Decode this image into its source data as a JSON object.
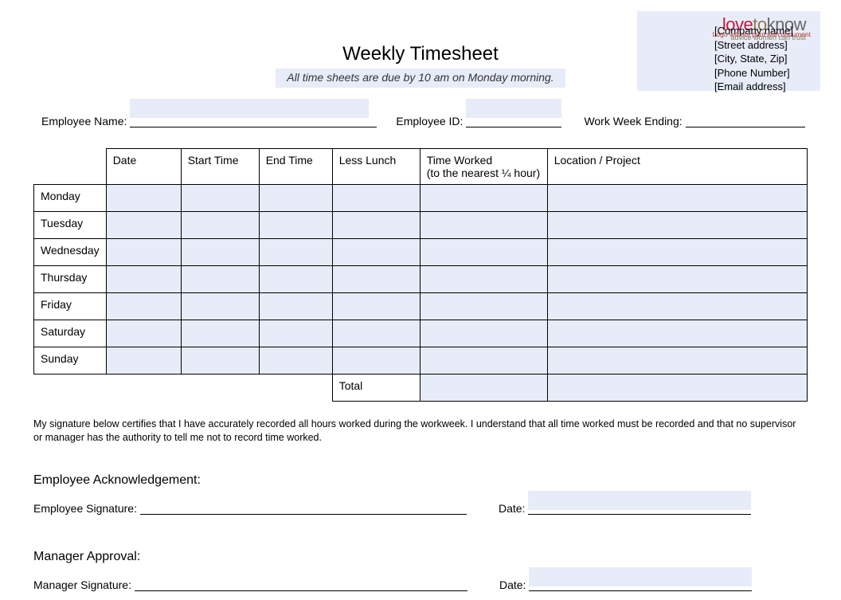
{
  "logo": {
    "love": "love",
    "to": "to",
    "know": "know",
    "tagline": "advice women can trust",
    "note": "Logo will not print with document"
  },
  "company": {
    "name": "[Company name]",
    "street": "[Street address]",
    "city": "[City, State, Zip]",
    "phone": "[Phone Number]",
    "email": "[Email address]"
  },
  "title": "Weekly Timesheet",
  "subtitle": "All time sheets are due by 10 am on Monday morning.",
  "labels": {
    "employee_name": "Employee Name:",
    "employee_id": "Employee ID:",
    "week_ending": "Work Week Ending:"
  },
  "headers": {
    "date": "Date",
    "start": "Start Time",
    "end": "End Time",
    "lunch": "Less Lunch",
    "worked": "Time Worked",
    "worked_sub": "(to the nearest ¼ hour)",
    "location": "Location / Project",
    "total": "Total"
  },
  "days": [
    "Monday",
    "Tuesday",
    "Wednesday",
    "Thursday",
    "Friday",
    "Saturday",
    "Sunday"
  ],
  "certification": "My signature below certifies that I have accurately recorded all hours worked during the workweek. I understand that all time worked must be recorded and that no supervisor or manager has the authority to tell me not to record time worked.",
  "sig": {
    "emp_heading": "Employee Acknowledgement:",
    "emp_label": "Employee Signature:",
    "mgr_heading": "Manager Approval:",
    "mgr_label": "Manager Signature:",
    "date_label": "Date:"
  }
}
